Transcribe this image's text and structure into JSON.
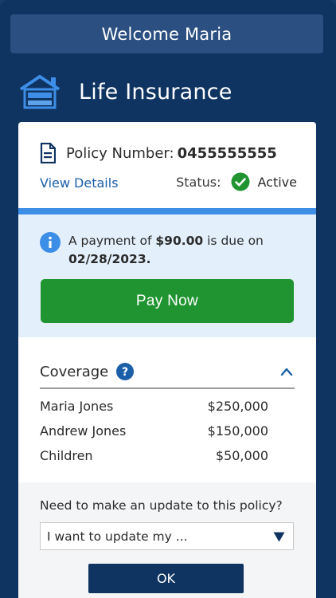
{
  "welcome": {
    "text": "Welcome Maria"
  },
  "header": {
    "title": "Life Insurance",
    "icon": "house-icon"
  },
  "policy": {
    "label": "Policy Number:",
    "number": "0455555555",
    "view_details": "View Details",
    "status_label": "Status:",
    "status_value": "Active"
  },
  "payment": {
    "text_prefix": "A payment of ",
    "amount": "$90.00",
    "text_middle": " is due on ",
    "due_date": "02/28/2023.",
    "pay_button": "Pay Now"
  },
  "coverage": {
    "title": "Coverage",
    "rows": [
      {
        "name": "Maria Jones",
        "amount": "$250,000"
      },
      {
        "name": "Andrew Jones",
        "amount": "$150,000"
      },
      {
        "name": "Children",
        "amount": "$50,000"
      }
    ]
  },
  "update": {
    "question": "Need to make an update to this policy?",
    "select_value": "I want to update my ...",
    "ok_button": "OK"
  },
  "colors": {
    "navy": "#0f3461",
    "accent_blue": "#3d8ee6",
    "success_green": "#1f9430",
    "link_blue": "#1b5fa8"
  }
}
